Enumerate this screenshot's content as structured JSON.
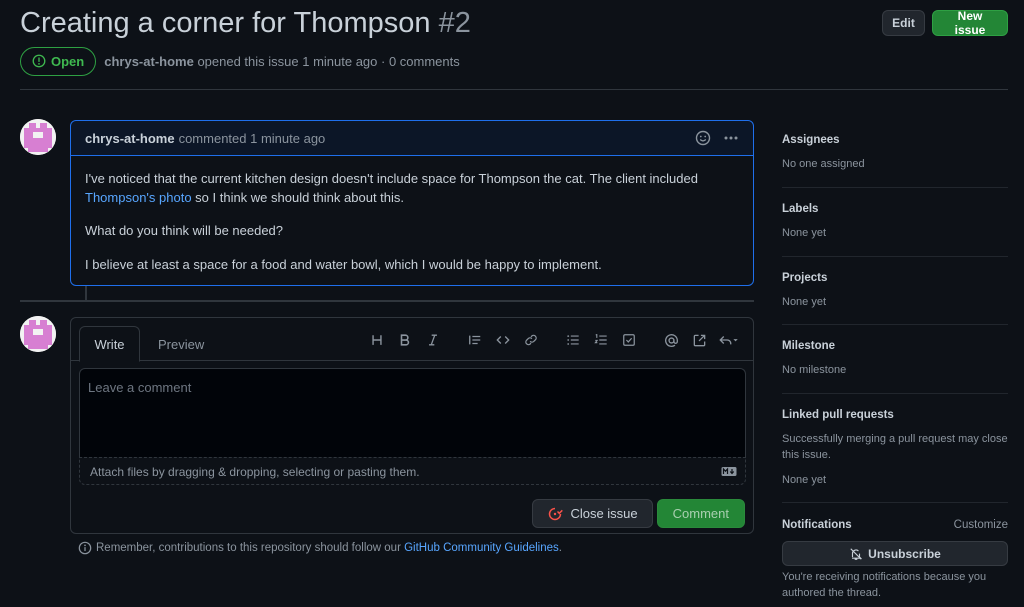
{
  "issue": {
    "title": "Creating a corner for Thompson",
    "number": "#2",
    "state": "Open",
    "author": "chrys-at-home",
    "opened_text": "opened this issue 1 minute ago · 0 comments"
  },
  "header": {
    "edit_label": "Edit",
    "new_issue_label": "New issue"
  },
  "comment": {
    "author": "chrys-at-home",
    "when": "commented 1 minute ago",
    "p1_before": "I've noticed that the current kitchen design doesn't include space for Thompson the cat. The client included ",
    "p1_link": "Thompson's photo",
    "p1_after": " so I think we should think about this.",
    "p2": "What do you think will be needed?",
    "p3": "I believe at least a space for a food and water bowl, which I would be happy to implement."
  },
  "composer": {
    "tab_write": "Write",
    "tab_preview": "Preview",
    "placeholder": "Leave a comment",
    "attach_text": "Attach files by dragging & dropping, selecting or pasting them.",
    "close_issue_label": "Close issue",
    "comment_label": "Comment",
    "toolbar_icons": [
      "heading-icon",
      "bold-icon",
      "italic-icon",
      "quote-icon",
      "code-icon",
      "link-icon",
      "bulleted-list-icon",
      "numbered-list-icon",
      "task-list-icon",
      "mention-icon",
      "reference-icon",
      "reply-icon"
    ]
  },
  "guidelines": {
    "before": "Remember, contributions to this repository should follow our ",
    "link": "GitHub Community Guidelines",
    "after": "."
  },
  "sidebar": {
    "assignees_title": "Assignees",
    "assignees_value": "No one assigned",
    "labels_title": "Labels",
    "labels_value": "None yet",
    "projects_title": "Projects",
    "projects_value": "None yet",
    "milestone_title": "Milestone",
    "milestone_value": "No milestone",
    "linked_title": "Linked pull requests",
    "linked_desc": "Successfully merging a pull request may close this issue.",
    "linked_value": "None yet",
    "notifications_title": "Notifications",
    "customize_label": "Customize",
    "unsubscribe_label": "Unsubscribe",
    "notifications_desc": "You're receiving notifications because you authored the thread."
  },
  "colors": {
    "open_green": "#3fb950",
    "button_green": "#238636",
    "link_blue": "#58a6ff",
    "avatar_pink": "#d77fd2"
  }
}
